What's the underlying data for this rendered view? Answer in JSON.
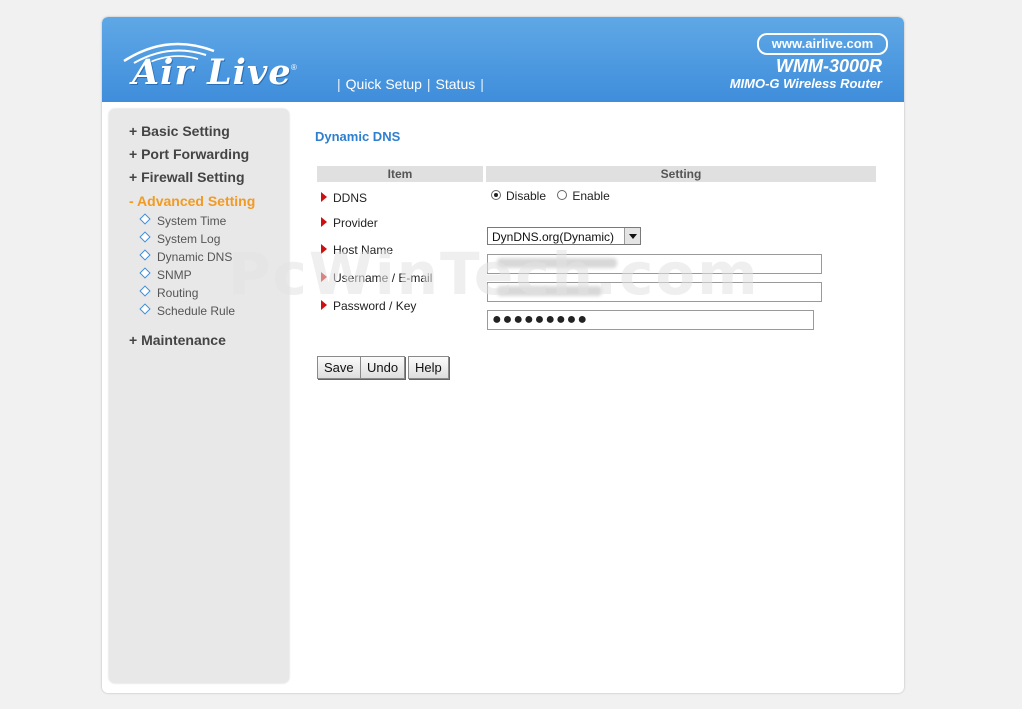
{
  "header": {
    "logo_text": "Air Live",
    "logo_mark": "®",
    "nav": [
      {
        "label": "Quick Setup"
      },
      {
        "label": "Status"
      }
    ],
    "nav_separator": "|",
    "site_url": "www.airlive.com",
    "model": "WMM-3000R",
    "model_sub": "MIMO-G Wireless Router"
  },
  "sidebar": {
    "items": [
      {
        "label": "+ Basic Setting",
        "active": false
      },
      {
        "label": "+ Port Forwarding",
        "active": false
      },
      {
        "label": "+ Firewall Setting",
        "active": false
      },
      {
        "label": "- Advanced Setting",
        "active": true
      },
      {
        "label": "+ Maintenance",
        "active": false
      }
    ],
    "sub_items": [
      {
        "label": "System Time"
      },
      {
        "label": "System Log"
      },
      {
        "label": "Dynamic DNS"
      },
      {
        "label": "SNMP"
      },
      {
        "label": "Routing"
      },
      {
        "label": "Schedule Rule"
      }
    ]
  },
  "main": {
    "title": "Dynamic DNS",
    "table": {
      "headers": [
        "Item",
        "Setting"
      ],
      "rows": [
        {
          "label": "DDNS"
        },
        {
          "label": "Provider"
        },
        {
          "label": "Host Name"
        },
        {
          "label": "Username / E-mail"
        },
        {
          "label": "Password / Key"
        }
      ]
    },
    "ddns_options": [
      {
        "label": "Disable",
        "selected": true
      },
      {
        "label": "Enable",
        "selected": false
      }
    ],
    "provider_selected": "DynDNS.org(Dynamic)",
    "host_name_value": "",
    "username_value": "",
    "password_value": "●●●●●●●●●",
    "buttons": {
      "save": "Save",
      "undo": "Undo",
      "help": "Help"
    }
  },
  "watermark": "PcWinTech.com",
  "colors": {
    "header_blue": "#3f8ddb",
    "active_menu": "#f29a22",
    "title_blue": "#2e7fcf",
    "bullet_red": "#d01010"
  }
}
